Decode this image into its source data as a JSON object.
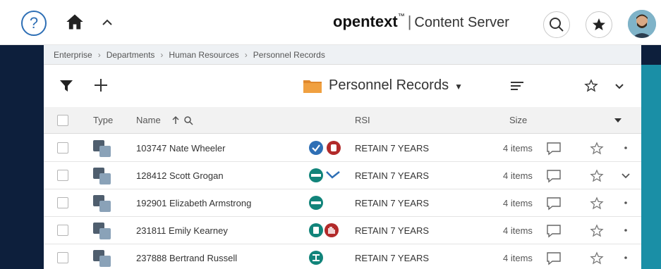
{
  "header": {
    "help_icon": "?",
    "brand_name": "opentext",
    "brand_tm": "™",
    "brand_separator": "|",
    "brand_product": "Content Server"
  },
  "breadcrumb": [
    "Enterprise",
    "Departments",
    "Human Resources",
    "Personnel Records"
  ],
  "toolbar": {
    "folder_title": "Personnel Records"
  },
  "table": {
    "columns": {
      "type": "Type",
      "name": "Name",
      "rsi": "RSI",
      "size": "Size"
    },
    "rows": [
      {
        "name": "103747 Nate Wheeler",
        "rsi": "RETAIN 7 YEARS",
        "size": "4 items",
        "indicators": [
          "check-badge",
          "hold-badge"
        ]
      },
      {
        "name": "128412 Scott Grogan",
        "rsi": "RETAIN 7 YEARS",
        "size": "4 items",
        "indicators": [
          "classify-badge"
        ]
      },
      {
        "name": "192901 Elizabeth Armstrong",
        "rsi": "RETAIN 7 YEARS",
        "size": "4 items",
        "indicators": [
          "classify-badge"
        ]
      },
      {
        "name": "231811 Emily Kearney",
        "rsi": "RETAIN 7 YEARS",
        "size": "4 items",
        "indicators": [
          "records-badge",
          "hold-badge"
        ]
      },
      {
        "name": "237888 Bertrand Russell",
        "rsi": "RETAIN 7 YEARS",
        "size": "4 items",
        "indicators": [
          "workflow-badge"
        ]
      }
    ]
  },
  "colors": {
    "accent": "#2e6fb5",
    "teal": "#11847a",
    "hold_red": "#b22a2a",
    "nav_dark": "#0d1f3c",
    "folder_orange": "#e0882c"
  },
  "icons": [
    "help-icon",
    "home-icon",
    "chevron-up-icon",
    "search-icon",
    "star-icon",
    "avatar",
    "filter-icon",
    "plus-icon",
    "folder-icon",
    "sort-icon",
    "comment-icon",
    "more-icon"
  ]
}
